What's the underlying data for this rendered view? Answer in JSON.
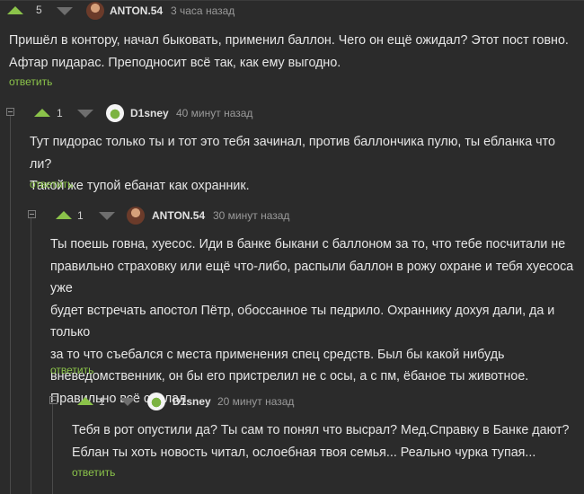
{
  "comments": [
    {
      "score": "5",
      "author": "ANTON.54",
      "time": "3 часа назад",
      "text": "Пришёл в контору, начал быковать, применил баллон. Чего он ещё ожидал? Этот пост говно.\nАфтар пидарас. Преподносит всё так, как ему выгодно.",
      "reply": "ответить"
    },
    {
      "score": "1",
      "author": "D1sney",
      "time": "40 минут назад",
      "text": "Тут пидорас только ты и тот это тебя зачинал, против баллончика пулю, ты ебланка что ли?\nТакой же тупой ебанат как охранник.",
      "reply": "ответить"
    },
    {
      "score": "1",
      "author": "ANTON.54",
      "time": "30 минут назад",
      "text": "Ты поешь говна, хуесос. Иди в банке быкани с баллоном за то, что тебе посчитали не\nправильно страховку или ещё что-либо, распыли баллон в рожу охране и тебя хуесоса уже\nбудет встречать апостол Пётр, обоссанное ты педрило. Охраннику дохуя дали, да и только\nза то что съебался с места применения спец средств. Был бы какой нибудь\nвневедомственник, он бы его пристрелил не с осы, а с пм, ёбаное ты животное.\nПравильно всё сделал.",
      "reply": "ответить"
    },
    {
      "score": "1",
      "author": "D1sney",
      "time": "20 минут назад",
      "text": "Тебя в рот опустили да? Ты сам то понял что высрал? Мед.Справку в Банке дают?\nЕблан ты хоть новость читал, ослоебная твоя семья... Реально чурка тупая...",
      "reply": "ответить"
    }
  ]
}
